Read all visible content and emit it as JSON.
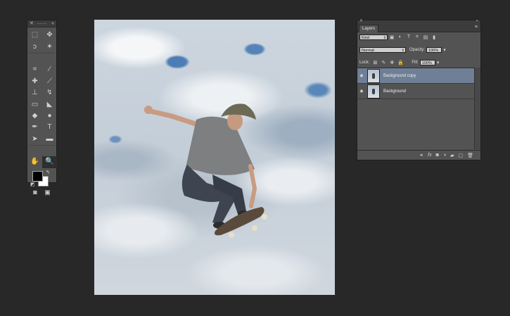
{
  "tools_panel": {
    "tools": [
      {
        "name": "rectangular-marquee-icon",
        "glyph": "⬚"
      },
      {
        "name": "move-tool-icon",
        "glyph": "✥"
      },
      {
        "name": "lasso-icon",
        "glyph": "ↄ"
      },
      {
        "name": "magic-wand-icon",
        "glyph": "✶"
      },
      {
        "name": "crop-icon",
        "glyph": "⌗"
      },
      {
        "name": "eyedropper-icon",
        "glyph": "⁄"
      },
      {
        "name": "spot-healing-icon",
        "glyph": "✚"
      },
      {
        "name": "brush-icon",
        "glyph": "⟋"
      },
      {
        "name": "clone-stamp-icon",
        "glyph": "⊥"
      },
      {
        "name": "history-brush-icon",
        "glyph": "↯"
      },
      {
        "name": "eraser-icon",
        "glyph": "▭"
      },
      {
        "name": "paint-bucket-icon",
        "glyph": "◣"
      },
      {
        "name": "blur-icon",
        "glyph": "◆"
      },
      {
        "name": "dodge-icon",
        "glyph": "●"
      },
      {
        "name": "pen-icon",
        "glyph": "✒"
      },
      {
        "name": "type-icon",
        "glyph": "T"
      },
      {
        "name": "path-selection-icon",
        "glyph": "➤"
      },
      {
        "name": "rectangle-shape-icon",
        "glyph": "▬"
      },
      {
        "name": "hand-icon",
        "glyph": "✋"
      },
      {
        "name": "zoom-icon",
        "glyph": "🔍"
      }
    ],
    "close_glyph": "✕",
    "collapse_glyph": "«",
    "swap_glyph": "↰",
    "default_colors_glyph": "◩",
    "quick_mask_glyph": "◙",
    "screen_mode_glyph": "▣"
  },
  "layers_panel": {
    "tab_label": "Layers",
    "close_glyph": "✕",
    "collapse_glyph": "«",
    "menu_glyph": "≡",
    "filter_kind": "Kind",
    "filter_icons": [
      "image-filter-icon",
      "adjustment-filter-icon",
      "type-filter-icon",
      "shape-filter-icon",
      "smart-object-filter-icon",
      "filter-toggle-icon"
    ],
    "blend_mode": "Normal",
    "opacity_label": "Opacity:",
    "opacity_value": "100%",
    "lock_label": "Lock:",
    "fill_label": "Fill:",
    "fill_value": "100%",
    "layers": [
      {
        "name": "Background copy",
        "selected": true
      },
      {
        "name": "Background",
        "selected": false
      }
    ],
    "bottom_icons": [
      "link-icon",
      "fx-icon",
      "mask-icon",
      "adjustment-icon",
      "folder-icon",
      "new-layer-icon",
      "trash-icon"
    ]
  },
  "colors": {
    "app_background": "#282828",
    "panel": "#535353",
    "selected_layer": "#6f7f96",
    "foreground_color": "#000000",
    "background_color": "#ffffff"
  }
}
